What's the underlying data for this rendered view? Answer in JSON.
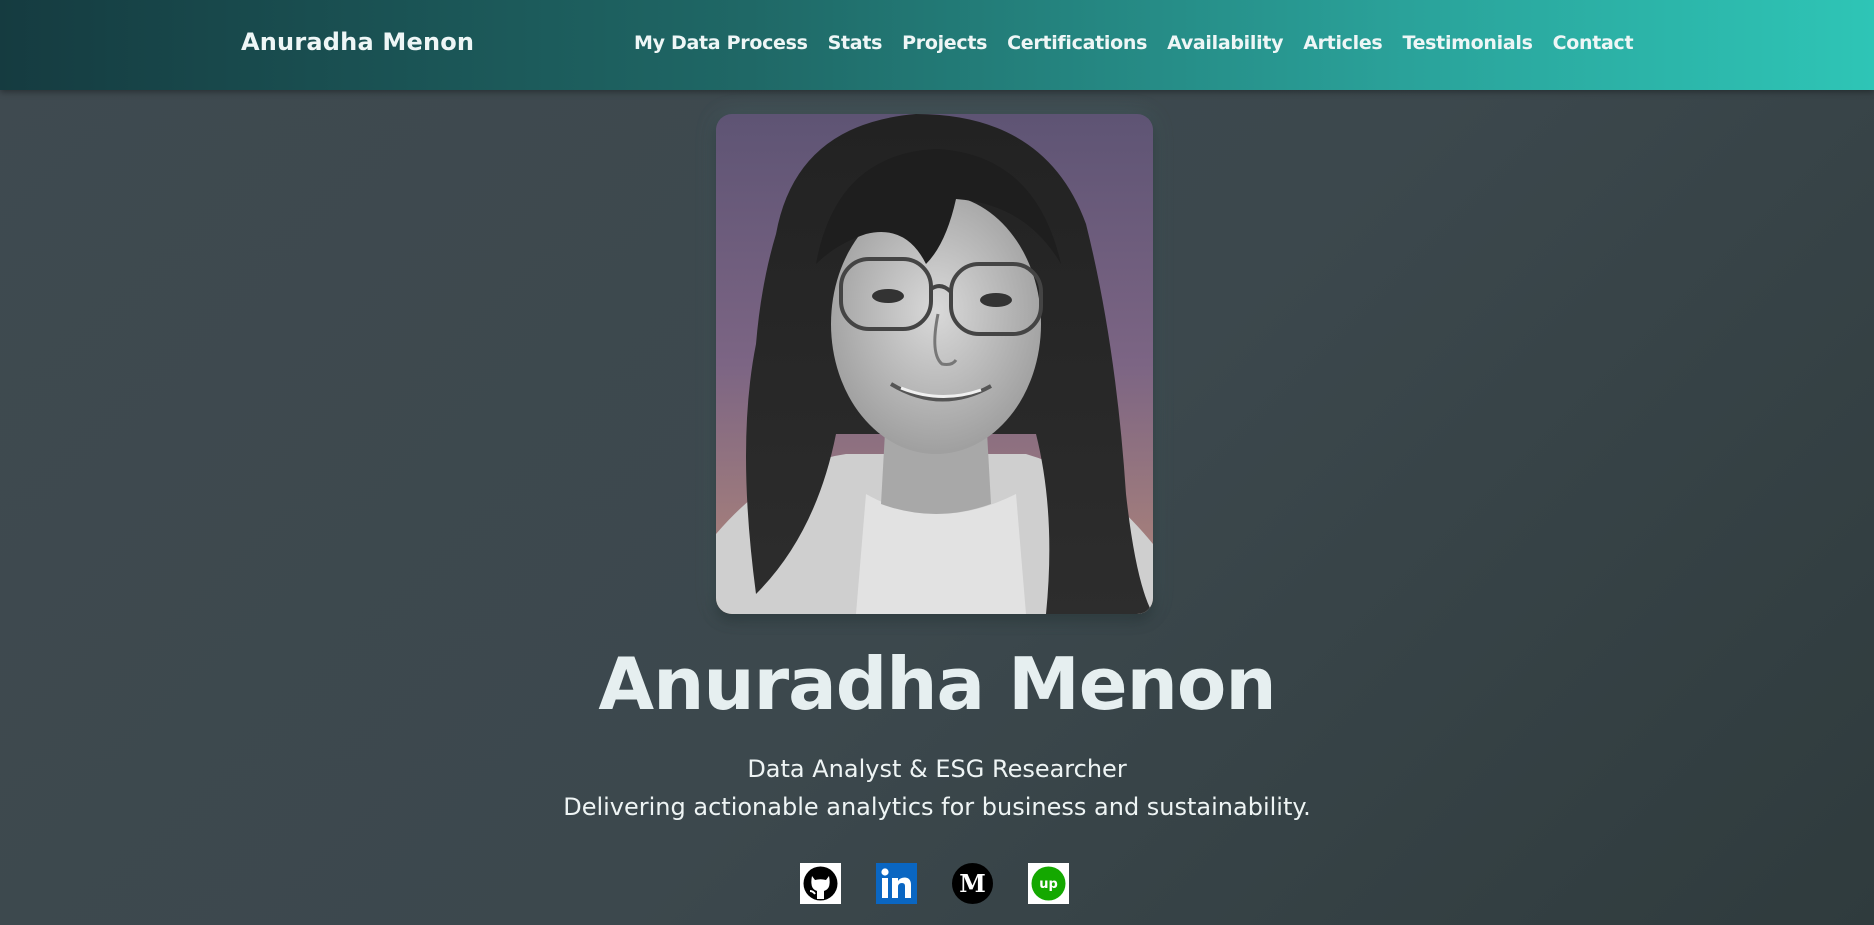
{
  "header": {
    "brand": "Anuradha Menon",
    "nav": [
      {
        "label": "My Data Process"
      },
      {
        "label": "Stats"
      },
      {
        "label": "Projects"
      },
      {
        "label": "Certifications"
      },
      {
        "label": "Availability"
      },
      {
        "label": "Articles"
      },
      {
        "label": "Testimonials"
      },
      {
        "label": "Contact"
      }
    ]
  },
  "hero": {
    "name": "Anuradha Menon",
    "role": "Data Analyst & ESG Researcher",
    "tagline": "Delivering actionable analytics for business and sustainability."
  },
  "social": [
    {
      "icon": "github-icon"
    },
    {
      "icon": "linkedin-icon",
      "color": "#0a66c2"
    },
    {
      "icon": "medium-icon",
      "color": "#000000"
    },
    {
      "icon": "upwork-icon",
      "color": "#14a800"
    }
  ],
  "colors": {
    "nav_start": "#153b40",
    "nav_end": "#2ec5b6",
    "background": "#3c484d"
  }
}
